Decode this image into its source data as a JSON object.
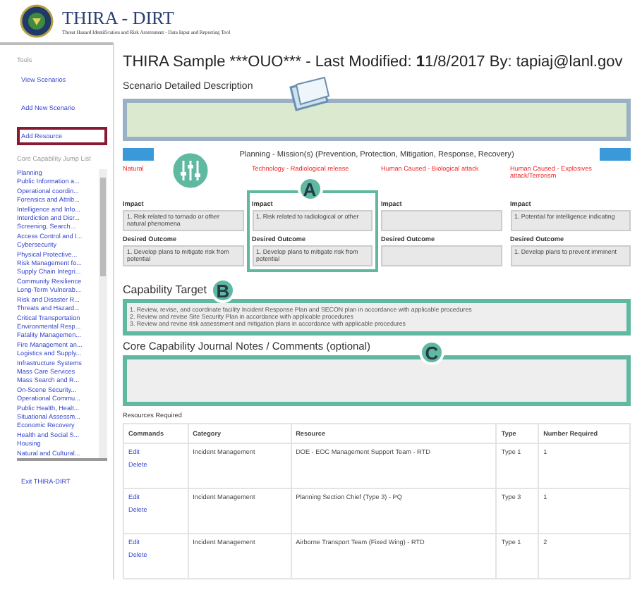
{
  "header": {
    "title": "THIRA - DIRT",
    "subtitle": "Threat Hazard Identification and Risk Assessment - Data Input and Reporting Tool"
  },
  "sidebar": {
    "tools_label": "Tools",
    "tools": [
      {
        "label": "View Scenarios",
        "highlighted": false
      },
      {
        "label": "Add New Scenario",
        "highlighted": false
      },
      {
        "label": "Add Resource",
        "highlighted": true
      }
    ],
    "jump_label": "Core Capability Jump List",
    "jump_list": [
      "Planning",
      "Public Information a...",
      "Operational coordin...",
      "Forensics and Attrib...",
      "Intelligence and Info...",
      "Interdiction and Disr...",
      "Screening, Search...",
      "Access Control and I...",
      "Cybersecurity",
      "Physical Protective...",
      "Risk Management fo...",
      "Supply Chain Integri...",
      "Community Resilience",
      "Long-Term Vulnerab...",
      "Risk and Disaster R...",
      "Threats and Hazard...",
      "Critical Transportation",
      "Environmental Resp...",
      "Fatality Managemen...",
      "Fire Management an...",
      "Logistics and Supply...",
      "Infrastructure Systems",
      "Mass Care Services",
      "Mass Search and R...",
      "On-Scene Security...",
      "Operational Commu...",
      "Public Health, Healt...",
      "Situational Assessm...",
      "Economic Recovery",
      "Health and Social S...",
      "Housing",
      "Natural and Cultural..."
    ],
    "exit": "Exit THIRA-DIRT"
  },
  "title": {
    "prefix": "THIRA Sample ***OUO*** - Last Modified: ",
    "date": "**1**1/8/2017",
    "by": " By: tapiaj@lanl.gov"
  },
  "description": {
    "label": "Scenario Detailed Description"
  },
  "mission": "Planning - Mission(s) (Prevention, Protection, Mitigation, Response, Recovery)",
  "hazards": [
    {
      "name": "Natural",
      "impact_label": "Impact",
      "impact": "1.   Risk related to tornado or other natural phenomena",
      "outcome_label": "Desired Outcome",
      "outcome": "1.   Develop plans to mitigate risk from potential"
    },
    {
      "name": "Technology - Radiological release",
      "impact_label": "Impact",
      "impact": "1.   Risk related to radiological or other",
      "outcome_label": "Desired Outcome",
      "outcome": "1.   Develop plans to mitigate risk from potential",
      "callout": "A"
    },
    {
      "name": "Human Caused - Biological attack",
      "impact_label": "Impact",
      "outcome_label": "Desired Outcome"
    },
    {
      "name": "Human Caused - Explosives attack/Terrorism",
      "impact_label": "Impact",
      "impact": "1.   Potential for intelligence indicating",
      "outcome_label": "Desired Outcome",
      "outcome": "1.   Develop plans to prevent imminent"
    }
  ],
  "capability": {
    "label": "Capability Target",
    "callout": "B",
    "lines": [
      "1. Review, revise, and coordinate facility Incident Response Plan and SECON plan in accordance with applicable procedures",
      "2. Review and revise Site Security Plan in accordance with applicable procedures",
      "3. Review and revise risk assessment and mitigation plans in accordance with applicable procedures"
    ]
  },
  "journal": {
    "label": "Core Capability Journal Notes / Comments (optional)",
    "callout": "C"
  },
  "resources": {
    "label": "Resources Required",
    "columns": [
      "Commands",
      "Category",
      "Resource",
      "Type",
      "Number Required"
    ],
    "rows": [
      {
        "edit": "Edit",
        "delete": "Delete",
        "category": "Incident Management",
        "resource": "DOE - EOC Management Support Team - RTD",
        "type": "Type 1",
        "number": "1"
      },
      {
        "edit": "Edit",
        "delete": "Delete",
        "category": "Incident Management",
        "resource": "Planning Section Chief (Type 3) - PQ",
        "type": "Type 3",
        "number": "1"
      },
      {
        "edit": "Edit",
        "delete": "Delete",
        "category": "Incident Management",
        "resource": "Airborne Transport Team (Fixed Wing) - RTD",
        "type": "Type 1",
        "number": "2"
      }
    ]
  }
}
